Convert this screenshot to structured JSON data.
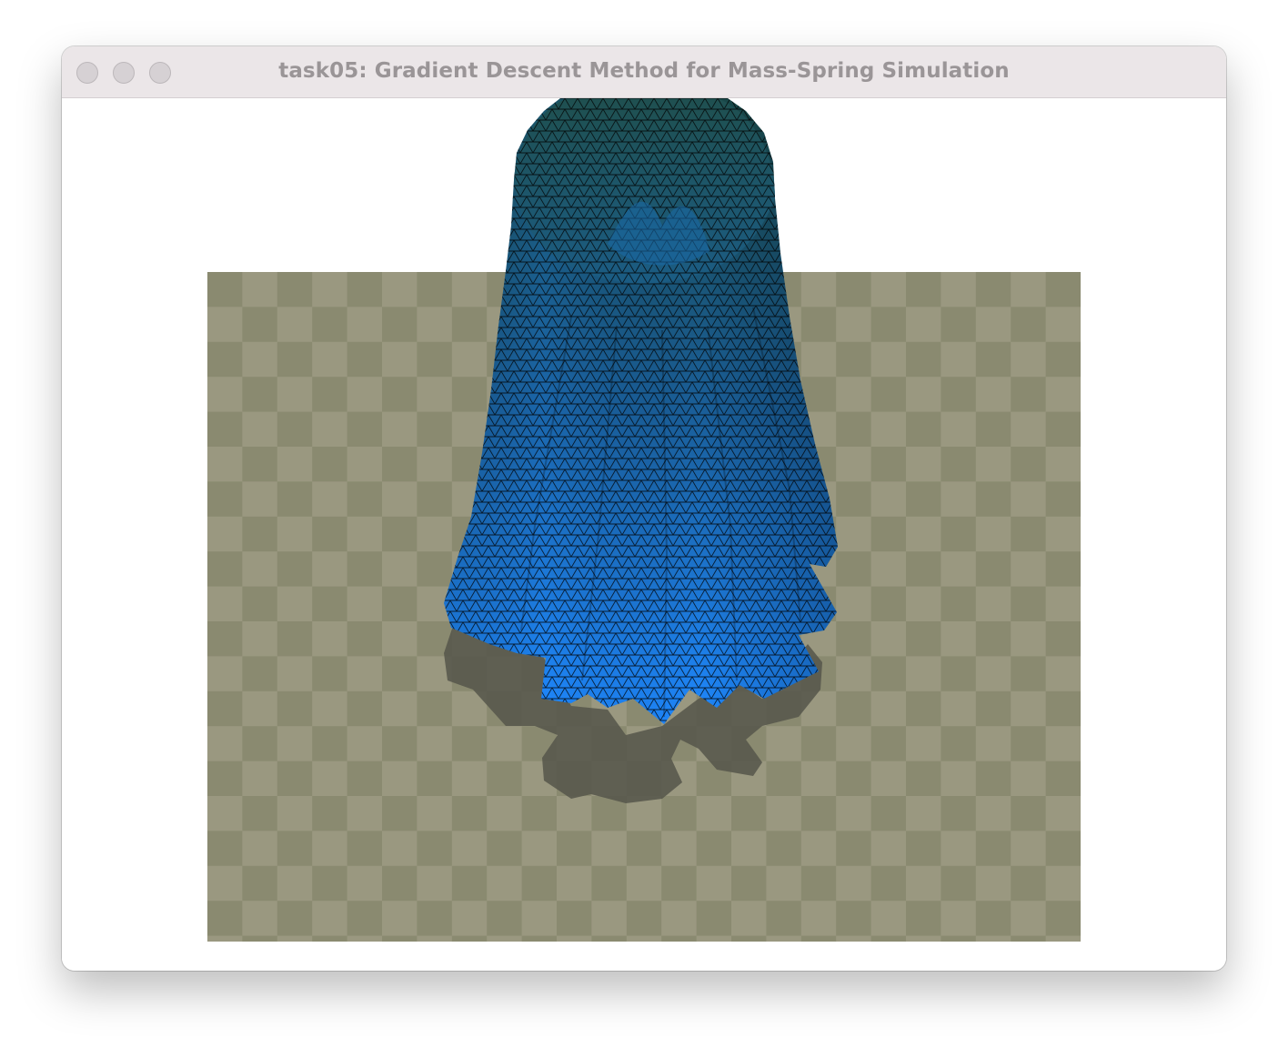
{
  "window": {
    "title": "task05: Gradient Descent Method for Mass-Spring Simulation"
  },
  "scene": {
    "background_color": "#ffffff",
    "floor_colors": [
      "#9a9880",
      "#8a8a70"
    ],
    "shadow_color": "#55554a",
    "cloth_colors": {
      "top": "#1a4a4a",
      "mid": "#1a5f9a",
      "bottom": "#1e88ff"
    },
    "mesh_line_color": "#000000"
  }
}
